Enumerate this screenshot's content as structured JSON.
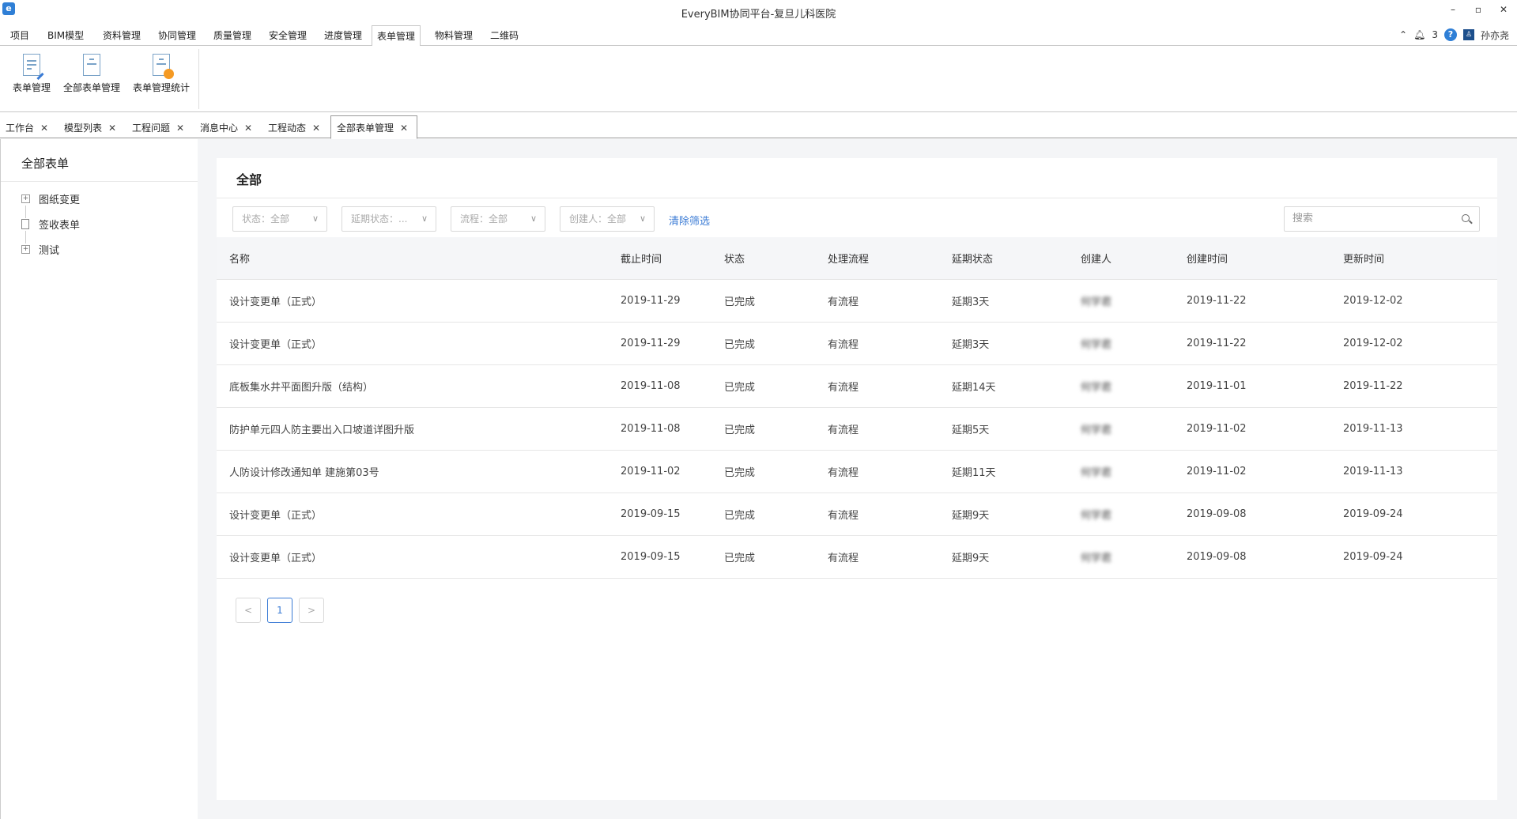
{
  "window": {
    "title": "EveryBIM协同平台-复旦儿科医院",
    "controls": [
      "–",
      "▫",
      "✕"
    ]
  },
  "menu": {
    "items": [
      "项目",
      "BIM模型",
      "资料管理",
      "协同管理",
      "质量管理",
      "安全管理",
      "进度管理",
      "表单管理",
      "物料管理",
      "二维码"
    ],
    "active": "表单管理"
  },
  "toolbar": {
    "notification_count": "3",
    "help": "?",
    "user_name": "孙亦尧"
  },
  "ribbon": {
    "buttons": [
      "表单管理",
      "全部表单管理",
      "表单管理统计"
    ]
  },
  "doc_tabs": [
    "工作台",
    "模型列表",
    "工程问题",
    "消息中心",
    "工程动态",
    "全部表单管理"
  ],
  "sidebar": {
    "title": "全部表单",
    "tree": [
      "图纸变更",
      "签收表单",
      "测试"
    ]
  },
  "panel": {
    "title": "全部",
    "filters": [
      "状态：全部",
      "延期状态：...",
      "流程：全部",
      "创建人：全部"
    ],
    "clear_filters": "清除筛选",
    "search_placeholder": "搜索"
  },
  "table": {
    "headers": [
      "名称",
      "截止时间",
      "状态",
      "处理流程",
      "延期状态",
      "创建人",
      "创建时间",
      "更新时间"
    ],
    "rows": [
      {
        "name": "设计变更单（正式）",
        "deadline": "2019-11-29",
        "status": "已完成",
        "flow": "有流程",
        "delay": "延期3天",
        "creator": "何学君",
        "created": "2019-11-22",
        "updated": "2019-12-02"
      },
      {
        "name": "设计变更单（正式）",
        "deadline": "2019-11-29",
        "status": "已完成",
        "flow": "有流程",
        "delay": "延期3天",
        "creator": "何学君",
        "created": "2019-11-22",
        "updated": "2019-12-02"
      },
      {
        "name": "底板集水井平面图升版（结构）",
        "deadline": "2019-11-08",
        "status": "已完成",
        "flow": "有流程",
        "delay": "延期14天",
        "creator": "何学君",
        "created": "2019-11-01",
        "updated": "2019-11-22"
      },
      {
        "name": "防护单元四人防主要出入口坡道详图升版",
        "deadline": "2019-11-08",
        "status": "已完成",
        "flow": "有流程",
        "delay": "延期5天",
        "creator": "何学君",
        "created": "2019-11-02",
        "updated": "2019-11-13"
      },
      {
        "name": "人防设计修改通知单 建施第03号",
        "deadline": "2019-11-02",
        "status": "已完成",
        "flow": "有流程",
        "delay": "延期11天",
        "creator": "何学君",
        "created": "2019-11-02",
        "updated": "2019-11-13"
      },
      {
        "name": "设计变更单（正式）",
        "deadline": "2019-09-15",
        "status": "已完成",
        "flow": "有流程",
        "delay": "延期9天",
        "creator": "何学君",
        "created": "2019-09-08",
        "updated": "2019-09-24"
      },
      {
        "name": "设计变更单（正式）",
        "deadline": "2019-09-15",
        "status": "已完成",
        "flow": "有流程",
        "delay": "延期9天",
        "creator": "何学君",
        "created": "2019-09-08",
        "updated": "2019-09-24"
      }
    ]
  },
  "pagination": {
    "prev": "<",
    "current": "1",
    "next": ">"
  },
  "colors": {
    "accent": "#3a7bd5",
    "delay": "#f06a1c"
  }
}
